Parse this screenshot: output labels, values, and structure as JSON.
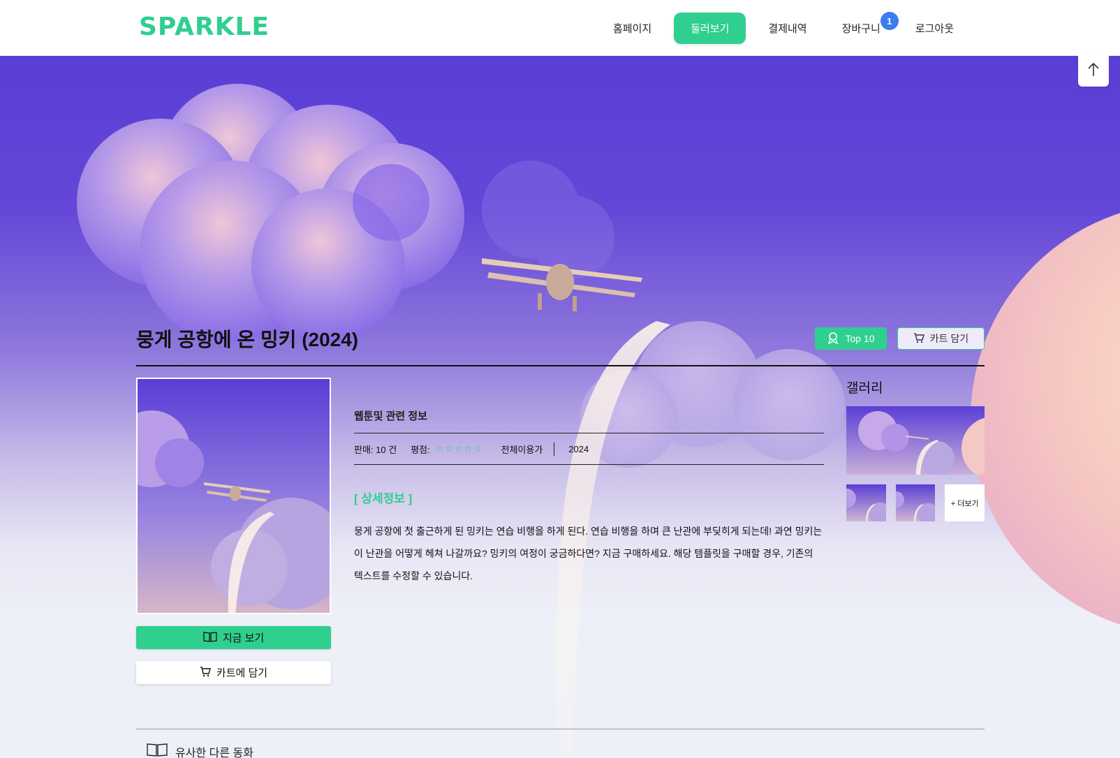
{
  "header": {
    "logo": "SPARKLE",
    "nav": [
      {
        "label": "홈페이지"
      },
      {
        "label": "둘러보기",
        "active": true
      },
      {
        "label": "결제내역"
      },
      {
        "label": "장바구니",
        "badge": "1"
      },
      {
        "label": "로그아웃"
      }
    ]
  },
  "product": {
    "title": "뭉게 공항에 온 밍키 (2024)",
    "top10_label": "Top 10",
    "cart_top_label": "카트 담기",
    "info_heading": "웹툰및 관련 정보",
    "sold": "판매: 10 건",
    "rating_label": "평점:",
    "stars": "☆☆☆☆☆",
    "age": "전체이용가",
    "year": "2024",
    "detail_heading": "[ 상세정보 ]",
    "description": "뭉게 공항에 첫 출근하게 된 밍키는 연습 비행을 하게 된다. 연습 비행을 하며 큰 난관에 부딪히게 되는데! 과연 밍키는 이 난관을 어떻게 헤쳐 나갈까요? 밍키의 여정이 궁금하다면? 지금 구매하세요. 해당 템플릿을 구매할 경우, 기존의 텍스트를 수정할 수 있습니다.",
    "watch_label": "지금 보기",
    "cart_label": "카트에 담기"
  },
  "gallery": {
    "title": "갤러리",
    "more_label": "+ 더보기"
  },
  "similar": {
    "label": "유사한 다른 동화"
  },
  "colors": {
    "accent": "#2fcf8f",
    "badge": "#3b7cf0",
    "sky_top": "#5a3ed6"
  },
  "icons": [
    "arrow-up-icon",
    "award-icon",
    "cart-icon",
    "book-icon"
  ]
}
